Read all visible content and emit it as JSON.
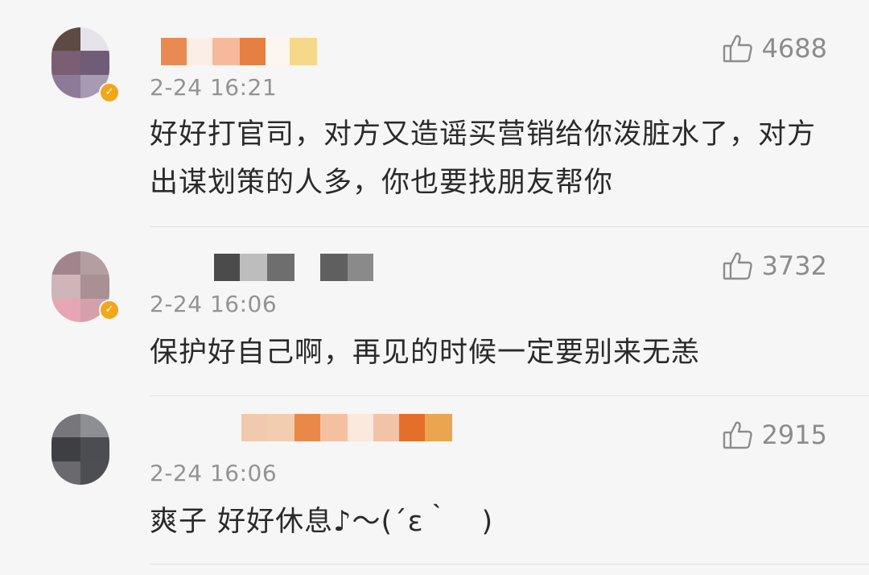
{
  "comments": [
    {
      "likes": "4688",
      "time": "2-24 16:21",
      "text": "好好打官司，对方又造谣买营销给你泼脏水了，对方出谋划策的人多，你也要找朋友帮你",
      "verified": true
    },
    {
      "likes": "3732",
      "time": "2-24 16:06",
      "text": "保护好自己啊，再见的时候一定要别来无恙",
      "verified": true
    },
    {
      "likes": "2915",
      "time": "2-24 16:06",
      "text": "爽子 好好休息♪～(´ε｀　)",
      "verified": false
    }
  ],
  "icons": {
    "like": "thumbs-up-icon",
    "verified": "verified-badge-icon"
  },
  "colors": {
    "background": "#f6f6f6",
    "text": "#2a2a2a",
    "meta": "#939393",
    "verified_badge": "#f2a61a"
  }
}
